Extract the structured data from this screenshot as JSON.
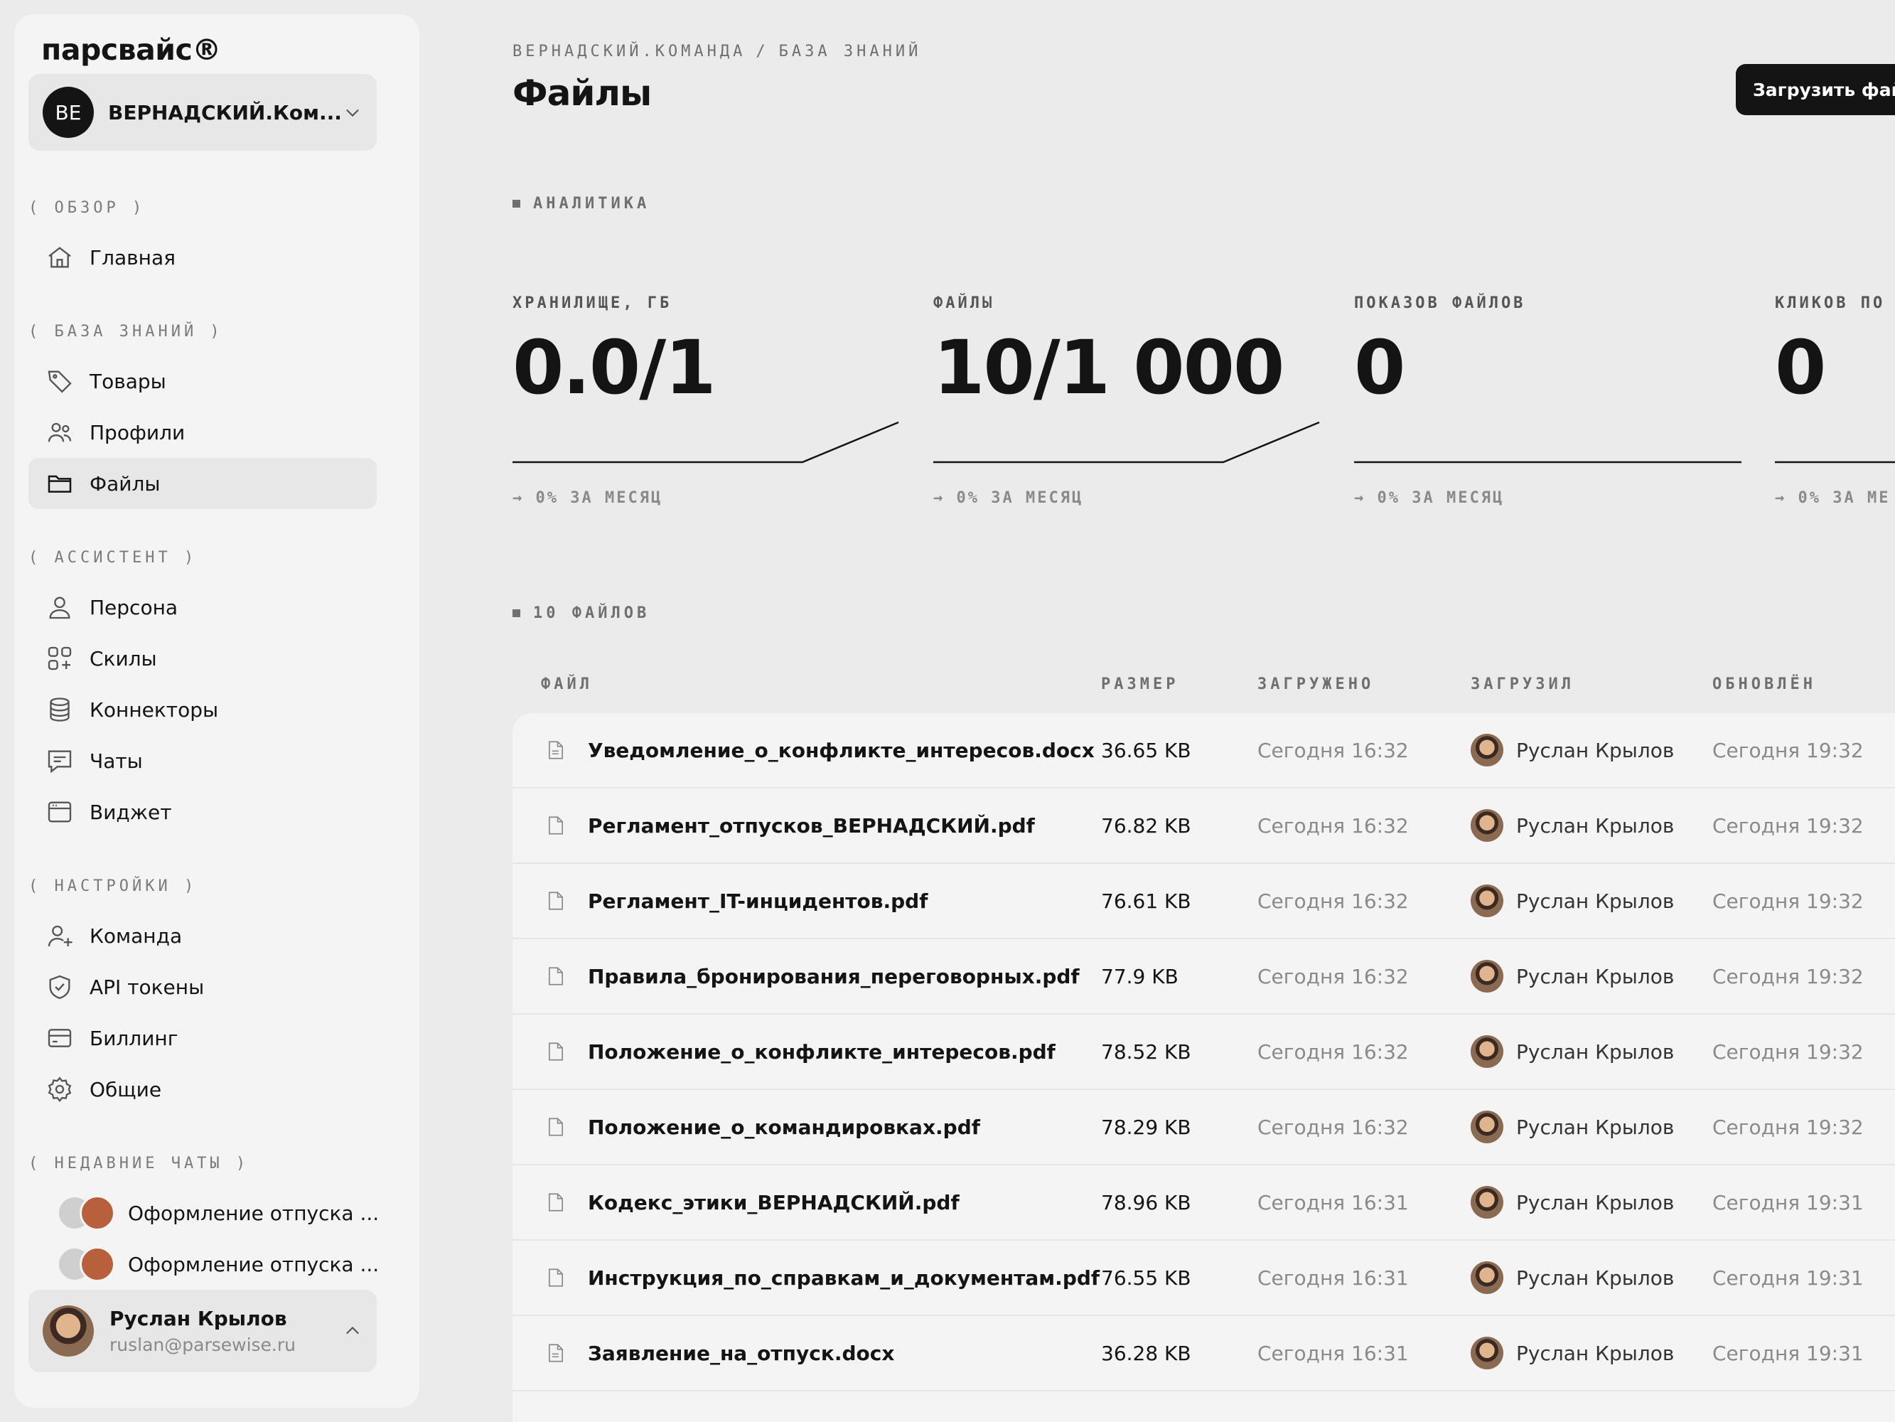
{
  "app": {
    "logo": "парсвайс®"
  },
  "org": {
    "initials": "ВЕ",
    "name": "ВЕРНАДСКИЙ.Ком..."
  },
  "sidebar": {
    "sections": [
      {
        "label": "( ОБЗОР )"
      },
      {
        "label": "( БАЗА ЗНАНИЙ )"
      },
      {
        "label": "( АССИСТЕНТ )"
      },
      {
        "label": "( НАСТРОЙКИ )"
      },
      {
        "label": "( НЕДАВНИЕ ЧАТЫ )"
      }
    ],
    "items": [
      {
        "label": "Главная",
        "icon": "home-icon"
      },
      {
        "label": "Товары",
        "icon": "tag-icon"
      },
      {
        "label": "Профили",
        "icon": "users-icon"
      },
      {
        "label": "Файлы",
        "icon": "folder-icon",
        "active": true
      },
      {
        "label": "Персона",
        "icon": "user-icon"
      },
      {
        "label": "Скилы",
        "icon": "grid-plus-icon"
      },
      {
        "label": "Коннекторы",
        "icon": "database-icon"
      },
      {
        "label": "Чаты",
        "icon": "chat-icon"
      },
      {
        "label": "Виджет",
        "icon": "window-icon"
      },
      {
        "label": "Команда",
        "icon": "user-plus-icon"
      },
      {
        "label": "API токены",
        "icon": "shield-check-icon"
      },
      {
        "label": "Биллинг",
        "icon": "card-icon"
      },
      {
        "label": "Общие",
        "icon": "gear-icon"
      }
    ],
    "recent_chats": [
      {
        "label": "Оформление отпуска ..."
      },
      {
        "label": "Оформление отпуска ..."
      }
    ]
  },
  "user": {
    "name": "Руслан Крылов",
    "email": "ruslan@parsewise.ru"
  },
  "header": {
    "breadcrumb": [
      "ВЕРНАДСКИЙ.КОМАНДА",
      "/",
      "БАЗА ЗНАНИЙ"
    ],
    "title": "Файлы",
    "upload_label": "Загрузить файл"
  },
  "analytics": {
    "label": "АНАЛИТИКА",
    "metrics": [
      {
        "label": "ХРАНИЛИЩЕ, ГБ",
        "value": "0.0/1",
        "delta": "→ 0% ЗА МЕСЯЦ",
        "trend": "up"
      },
      {
        "label": "ФАЙЛЫ",
        "value": "10/1 000",
        "delta": "→ 0% ЗА МЕСЯЦ",
        "trend": "up"
      },
      {
        "label": "ПОКАЗОВ ФАЙЛОВ",
        "value": "0",
        "delta": "→ 0% ЗА МЕСЯЦ",
        "trend": "flat"
      },
      {
        "label": "КЛИКОВ ПО",
        "value": "0",
        "delta": "→ 0% ЗА МЕ",
        "trend": "flat"
      }
    ]
  },
  "files": {
    "count_label": "10 ФАЙЛОВ",
    "columns": [
      "ФАЙЛ",
      "РАЗМЕР",
      "ЗАГРУЖЕНО",
      "ЗАГРУЗИЛ",
      "ОБНОВЛЁН"
    ],
    "rows": [
      {
        "name": "Уведомление_о_конфликте_интересов.docx",
        "size": "36.65 KB",
        "uploaded": "Сегодня 16:32",
        "uploader": "Руслан Крылов",
        "updated": "Сегодня 19:32"
      },
      {
        "name": "Регламент_отпусков_ВЕРНАДСКИЙ.pdf",
        "size": "76.82 KB",
        "uploaded": "Сегодня 16:32",
        "uploader": "Руслан Крылов",
        "updated": "Сегодня 19:32"
      },
      {
        "name": "Регламент_IT-инцидентов.pdf",
        "size": "76.61 KB",
        "uploaded": "Сегодня 16:32",
        "uploader": "Руслан Крылов",
        "updated": "Сегодня 19:32"
      },
      {
        "name": "Правила_бронирования_переговорных.pdf",
        "size": "77.9 KB",
        "uploaded": "Сегодня 16:32",
        "uploader": "Руслан Крылов",
        "updated": "Сегодня 19:32"
      },
      {
        "name": "Положение_о_конфликте_интересов.pdf",
        "size": "78.52 KB",
        "uploaded": "Сегодня 16:32",
        "uploader": "Руслан Крылов",
        "updated": "Сегодня 19:32"
      },
      {
        "name": "Положение_о_командировках.pdf",
        "size": "78.29 KB",
        "uploaded": "Сегодня 16:32",
        "uploader": "Руслан Крылов",
        "updated": "Сегодня 19:32"
      },
      {
        "name": "Кодекс_этики_ВЕРНАДСКИЙ.pdf",
        "size": "78.96 KB",
        "uploaded": "Сегодня 16:31",
        "uploader": "Руслан Крылов",
        "updated": "Сегодня 19:31"
      },
      {
        "name": "Инструкция_по_справкам_и_документам.pdf",
        "size": "76.55 KB",
        "uploaded": "Сегодня 16:31",
        "uploader": "Руслан Крылов",
        "updated": "Сегодня 19:31"
      },
      {
        "name": "Заявление_на_отпуск.docx",
        "size": "36.28 KB",
        "uploaded": "Сегодня 16:31",
        "uploader": "Руслан Крылов",
        "updated": "Сегодня 19:31"
      }
    ]
  }
}
